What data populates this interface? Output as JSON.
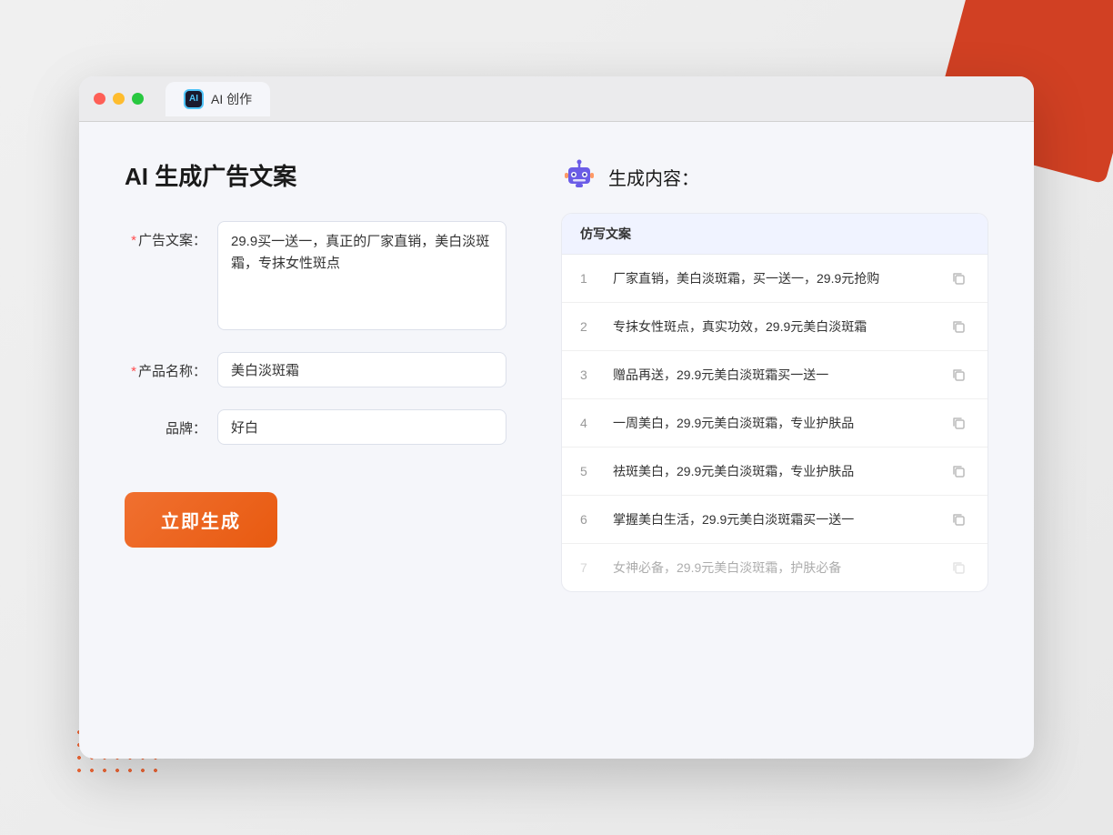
{
  "browser": {
    "tab_label": "AI 创作",
    "traffic_lights": [
      "red",
      "yellow",
      "green"
    ]
  },
  "page": {
    "title": "AI 生成广告文案",
    "form": {
      "ad_copy_label": "广告文案：",
      "ad_copy_required": "*",
      "ad_copy_value": "29.9买一送一，真正的厂家直销，美白淡斑霜，专抹女性斑点",
      "product_name_label": "产品名称：",
      "product_name_required": "*",
      "product_name_value": "美白淡斑霜",
      "brand_label": "品牌：",
      "brand_value": "好白",
      "generate_button_label": "立即生成"
    },
    "results": {
      "header_icon_alt": "robot",
      "header_title": "生成内容：",
      "table_header": "仿写文案",
      "items": [
        {
          "num": "1",
          "text": "厂家直销，美白淡斑霜，买一送一，29.9元抢购",
          "faded": false
        },
        {
          "num": "2",
          "text": "专抹女性斑点，真实功效，29.9元美白淡斑霜",
          "faded": false
        },
        {
          "num": "3",
          "text": "赠品再送，29.9元美白淡斑霜买一送一",
          "faded": false
        },
        {
          "num": "4",
          "text": "一周美白，29.9元美白淡斑霜，专业护肤品",
          "faded": false
        },
        {
          "num": "5",
          "text": "祛斑美白，29.9元美白淡斑霜，专业护肤品",
          "faded": false
        },
        {
          "num": "6",
          "text": "掌握美白生活，29.9元美白淡斑霜买一送一",
          "faded": false
        },
        {
          "num": "7",
          "text": "女神必备，29.9元美白淡斑霜，护肤必备",
          "faded": true
        }
      ]
    }
  }
}
